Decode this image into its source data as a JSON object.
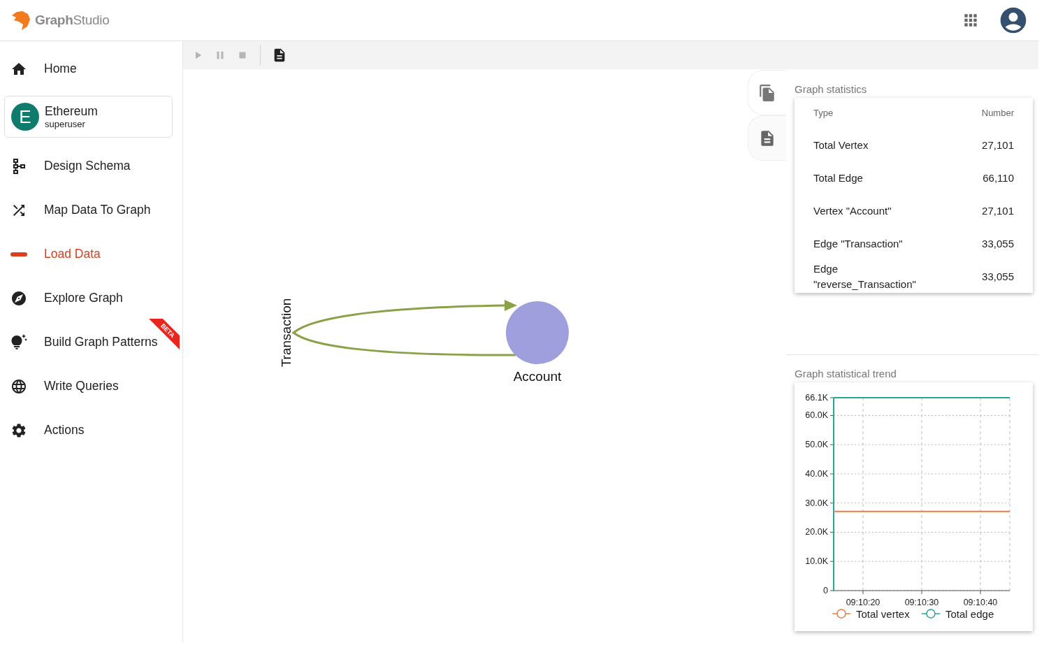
{
  "header": {
    "logo": "**Graph**Studio"
  },
  "sidebar": {
    "items": [
      {
        "kind": "link",
        "label": "Home",
        "selected": false
      },
      {
        "kind": "graph",
        "initial": "E",
        "name": "Ethereum",
        "role": "superuser",
        "selected": false
      },
      {
        "kind": "link",
        "label": "Design Schema",
        "selected": false
      },
      {
        "kind": "link",
        "label": "Map Data To Graph",
        "selected": false
      },
      {
        "kind": "link",
        "label": "Load Data",
        "selected": true
      },
      {
        "kind": "link",
        "label": "Explore Graph",
        "selected": false
      },
      {
        "kind": "link",
        "label": "Build Graph Patterns",
        "selected": false,
        "badge": "BETA"
      },
      {
        "kind": "link",
        "label": "Write Queries",
        "selected": false
      },
      {
        "kind": "link",
        "label": "Actions",
        "selected": false
      }
    ]
  },
  "toolbar": [
    {
      "kind": "play",
      "disabled": true
    },
    {
      "kind": "pause",
      "disabled": true
    },
    {
      "kind": "stop",
      "disabled": true
    },
    {
      "kind": "separator"
    },
    {
      "kind": "document",
      "disabled": false
    }
  ],
  "graph": {
    "nodes": [
      {
        "label": "Account",
        "color": "#9f9fde"
      }
    ],
    "edges": [
      {
        "label": "Transaction",
        "color": "#8aa148"
      }
    ]
  },
  "side_tabs": [
    {
      "kind": "documents",
      "selected": true
    },
    {
      "kind": "document",
      "selected": false
    }
  ],
  "statistics": {
    "title": "Graph statistics",
    "columns": [
      "Type",
      "Number"
    ],
    "rows": [
      [
        "Total Vertex",
        "27,101"
      ],
      [
        "Total Edge",
        "66,110"
      ],
      [
        "Vertex \"Account\"",
        "27,101"
      ],
      [
        "Edge \"Transaction\"",
        "33,055"
      ],
      [
        "Edge \"reverse_Transaction\"",
        "33,055"
      ]
    ]
  },
  "trend": {
    "title": "Graph statistical trend",
    "chart_data": {
      "type": "line",
      "grid": true,
      "legend": "bottom",
      "categories": [
        null,
        "09:10:20",
        null,
        "09:10:30",
        null,
        "09:10:40",
        null
      ],
      "ylim": [
        0,
        66100
      ],
      "yticks": [
        {
          "value": 0,
          "label": "0"
        },
        {
          "value": 10000,
          "label": "10.0K"
        },
        {
          "value": 20000,
          "label": "20.0K"
        },
        {
          "value": 30000,
          "label": "30.0K"
        },
        {
          "value": 40000,
          "label": "40.0K"
        },
        {
          "value": 50000,
          "label": "50.0K"
        },
        {
          "value": 60000,
          "label": "60.0K"
        },
        {
          "value": 66100,
          "label": "66.1K"
        }
      ],
      "series": [
        {
          "name": "Total vertex",
          "color": "#f07c3c",
          "values": [
            27100,
            27100,
            27100,
            27100,
            27100,
            27100,
            27100
          ]
        },
        {
          "name": "Total edge",
          "color": "#26a69a",
          "values": [
            66100,
            66100,
            66100,
            66100,
            66100,
            66100,
            66100
          ]
        }
      ]
    }
  }
}
